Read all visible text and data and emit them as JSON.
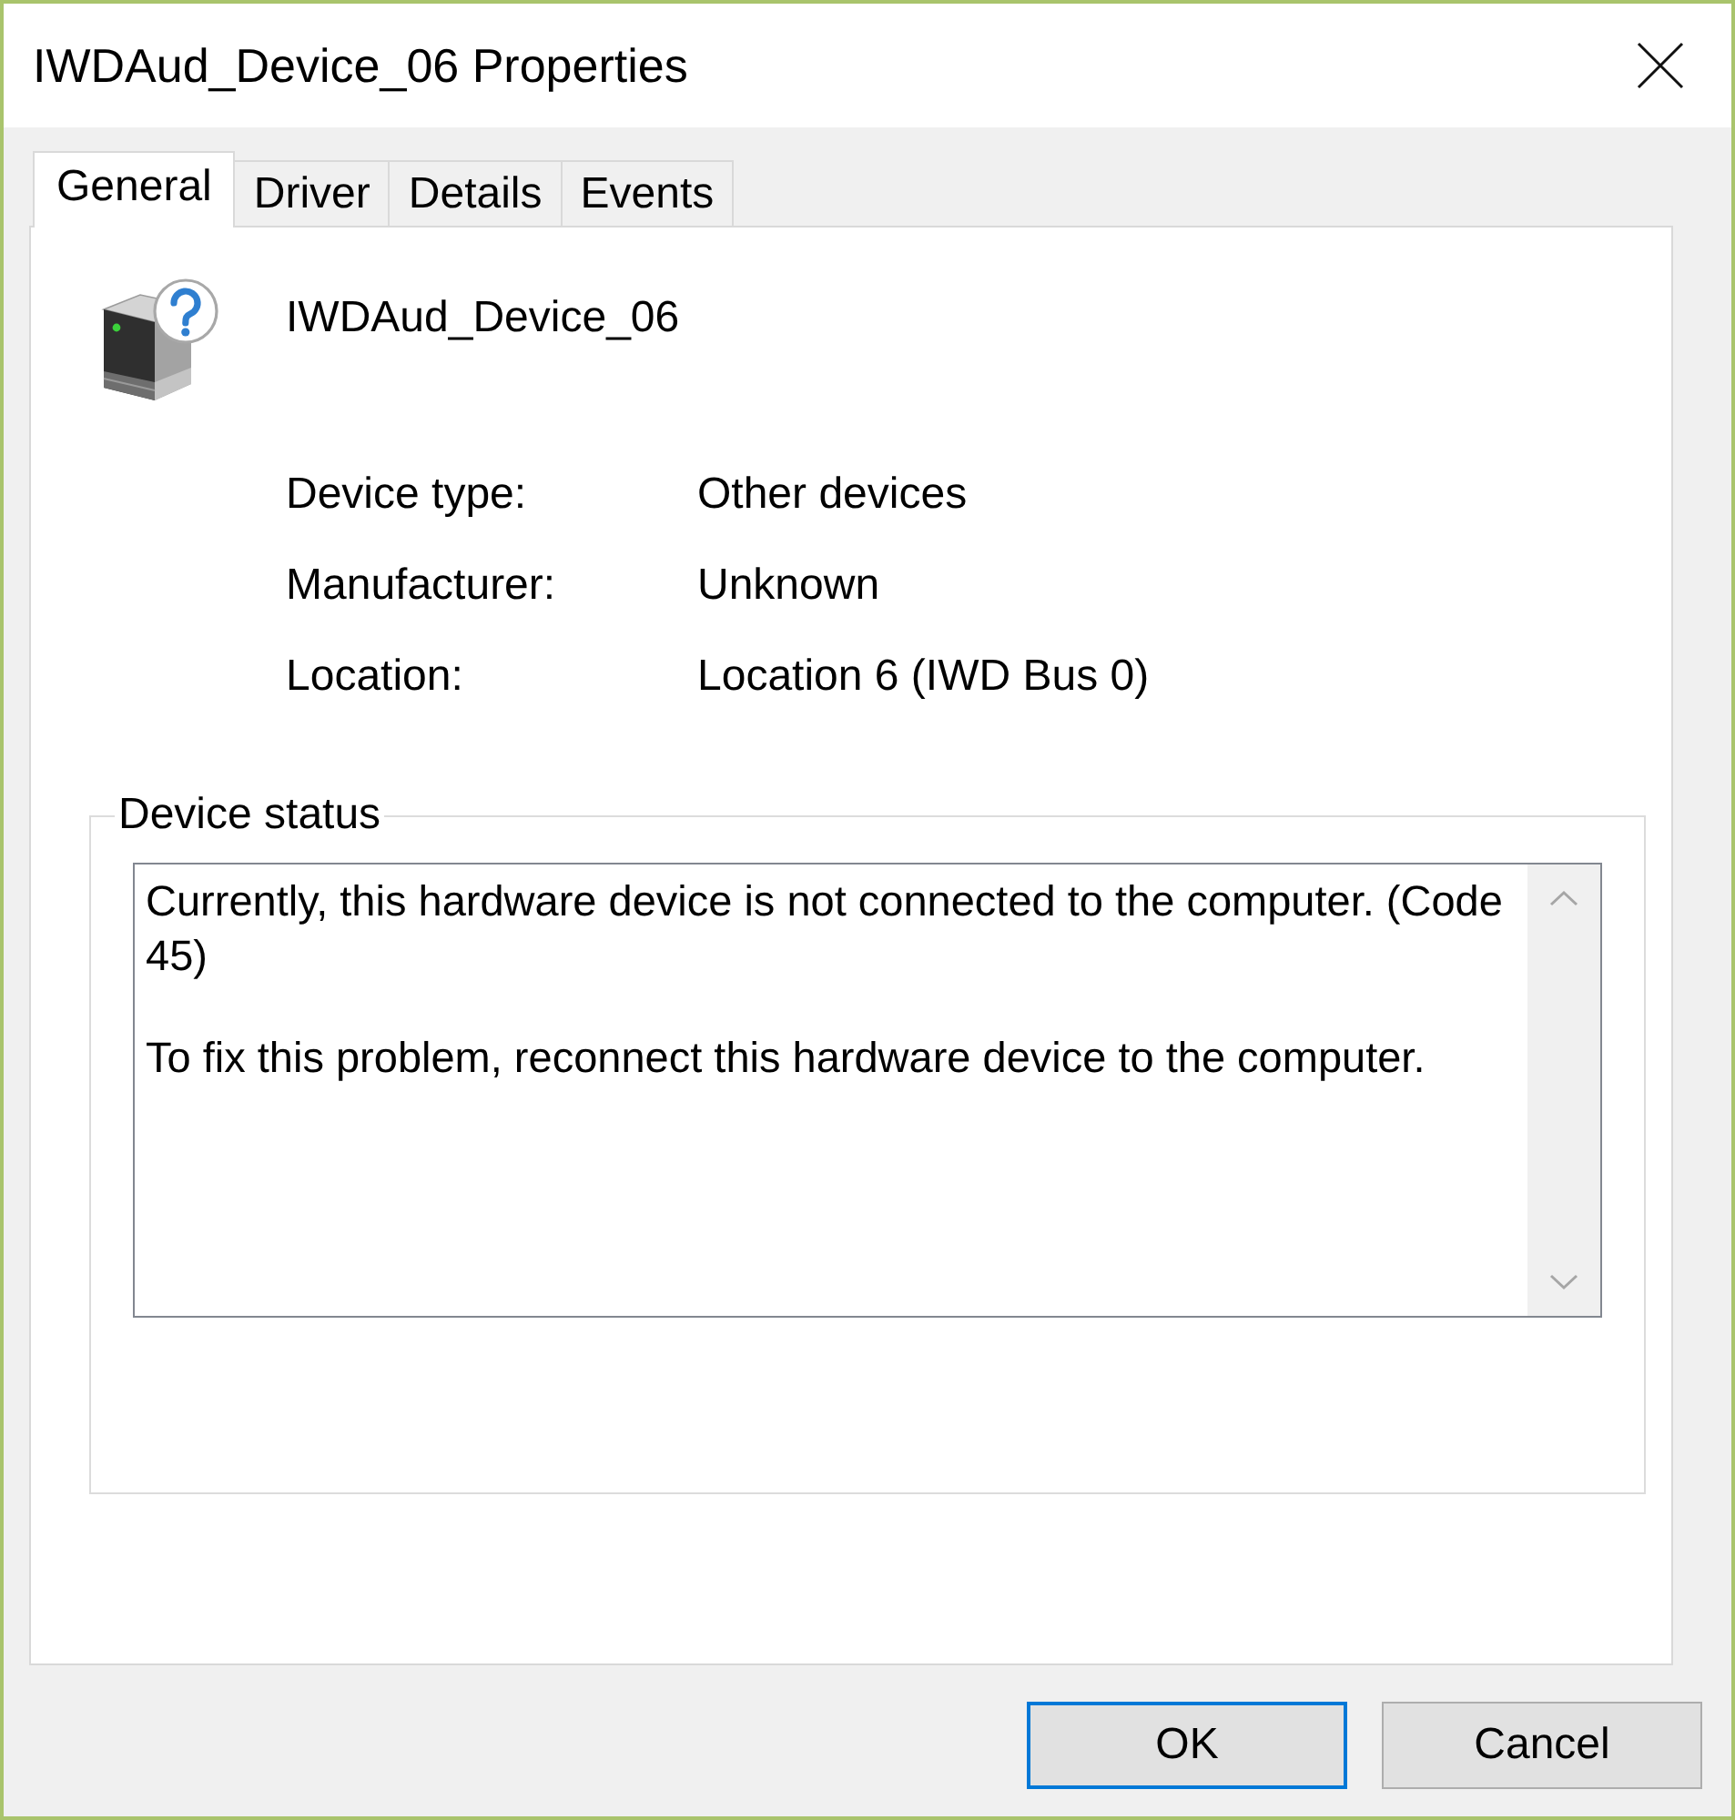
{
  "window": {
    "title": "IWDAud_Device_06 Properties"
  },
  "tabs": [
    {
      "label": "General",
      "selected": true
    },
    {
      "label": "Driver",
      "selected": false
    },
    {
      "label": "Details",
      "selected": false
    },
    {
      "label": "Events",
      "selected": false
    }
  ],
  "device": {
    "name": "IWDAud_Device_06"
  },
  "properties": [
    {
      "label": "Device type:",
      "value": "Other devices"
    },
    {
      "label": "Manufacturer:",
      "value": "Unknown"
    },
    {
      "label": "Location:",
      "value": "Location 6 (IWD Bus 0)"
    }
  ],
  "device_status": {
    "title": "Device status",
    "paragraphs": [
      "Currently, this hardware device is not connected to the computer. (Code 45)",
      "To fix this problem, reconnect this hardware device to the computer."
    ]
  },
  "buttons": [
    {
      "label": "OK",
      "default": true
    },
    {
      "label": "Cancel",
      "default": false
    }
  ]
}
